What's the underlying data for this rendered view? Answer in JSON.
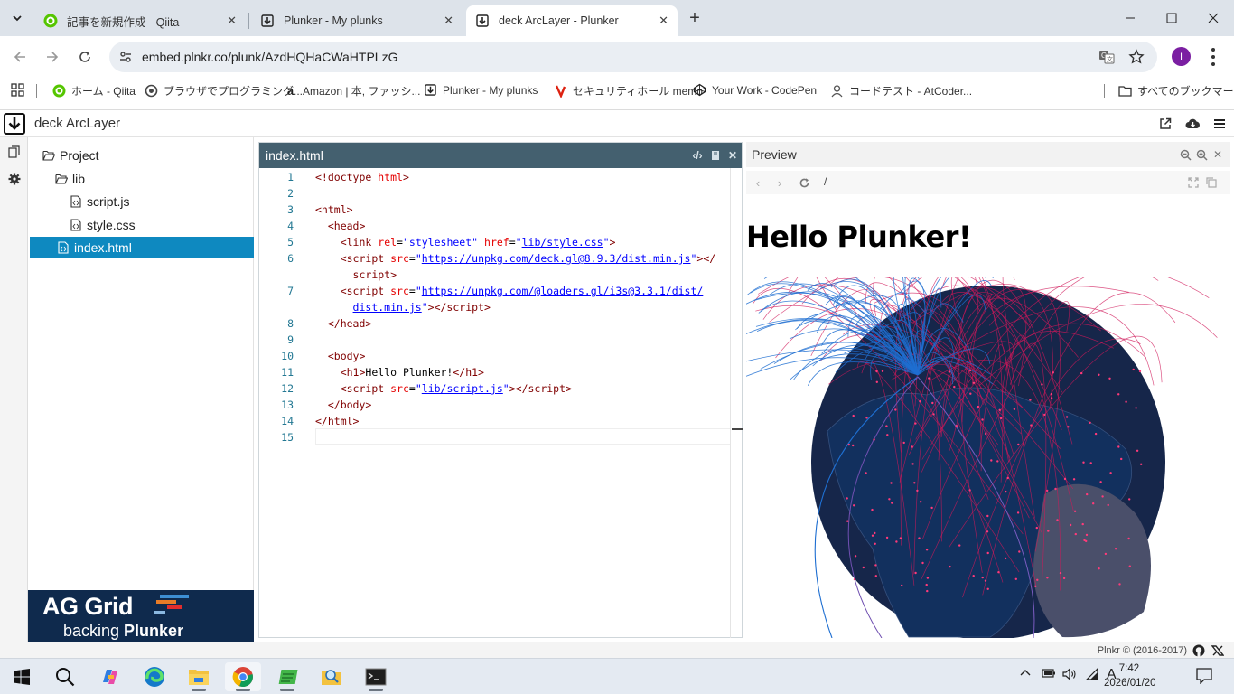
{
  "browser": {
    "tabs": [
      {
        "title": "記事を新規作成 - Qiita",
        "active": false,
        "icon": "qiita-icon"
      },
      {
        "title": "Plunker - My plunks",
        "active": false,
        "icon": "plunker-icon"
      },
      {
        "title": "deck ArcLayer - Plunker",
        "active": true,
        "icon": "plunker-icon"
      }
    ],
    "url": "embed.plnkr.co/plunk/AzdHQHaCWaHTPLzG",
    "profile_initial": "I",
    "bookmarks": [
      {
        "label": "ホーム - Qiita",
        "icon": "qiita-icon"
      },
      {
        "label": "ブラウザでプログラミング...",
        "icon": "paiza-icon"
      },
      {
        "label": "Amazon | 本, ファッシ...",
        "icon": "amazon-icon"
      },
      {
        "label": "Plunker - My plunks",
        "icon": "plunker-icon"
      },
      {
        "label": "セキュリティホール memo",
        "icon": "memo-icon"
      },
      {
        "label": "Your Work - CodePen",
        "icon": "codepen-icon"
      },
      {
        "label": "コードテスト - AtCoder...",
        "icon": "atcoder-icon"
      }
    ],
    "all_bookmarks": "すべてのブックマーク"
  },
  "plunker": {
    "title": "deck ArcLayer",
    "tree": {
      "root": "Project",
      "folder": "lib",
      "lib_files": [
        "script.js",
        "style.css"
      ],
      "selected_file": "index.html"
    },
    "banner": {
      "line1": "AG Grid",
      "line2_prefix": "backing ",
      "line2_bold": "Plunker"
    },
    "editor": {
      "filename": "index.html",
      "line_numbers": [
        "1",
        "2",
        "3",
        "4",
        "5",
        "6",
        "",
        "7",
        "",
        "8",
        "9",
        "10",
        "11",
        "12",
        "13",
        "14",
        "15"
      ]
    },
    "preview": {
      "title": "Preview",
      "path": "/",
      "heading": "Hello Plunker!"
    },
    "footer": "Plnkr © (2016-2017)"
  },
  "taskbar": {
    "time": "7:42",
    "date": "2026/01/20",
    "ime": "A"
  },
  "colors": {
    "tab_strip": "#dde3ea",
    "editor_header": "#44606f",
    "tree_selected": "#0e89c0",
    "banner_bg": "#0f2a4d",
    "globe_ocean": "#16264a",
    "globe_land": "#12305e",
    "arc_blue": "#1f6fd1",
    "arc_red": "#d0185a"
  }
}
